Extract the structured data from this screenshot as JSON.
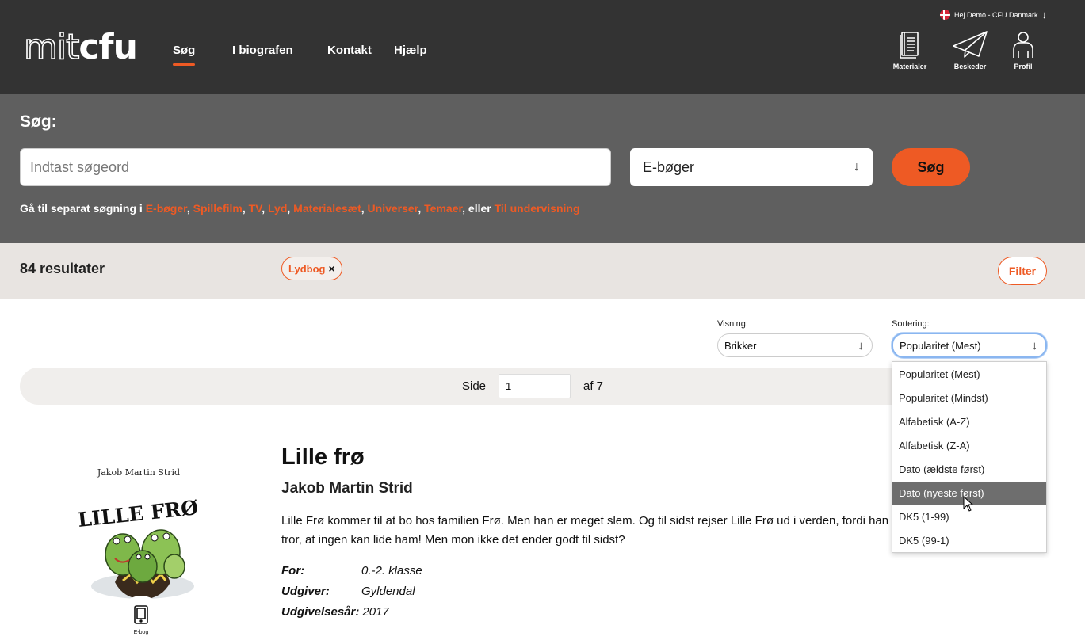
{
  "header": {
    "logo_thin": "mit",
    "logo_bold": "cfu",
    "nav": [
      {
        "label": "Søg",
        "active": true
      },
      {
        "label": "I biografen",
        "active": false
      },
      {
        "label": "Kontakt",
        "active": false
      },
      {
        "label": "Hjælp",
        "active": false
      }
    ],
    "greeting": "Hej Demo - CFU Danmark",
    "icons": [
      {
        "label": "Materialer",
        "icon": "book-icon"
      },
      {
        "label": "Beskeder",
        "icon": "paper-plane-icon"
      },
      {
        "label": "Profil",
        "icon": "person-icon"
      }
    ]
  },
  "search": {
    "title": "Søg:",
    "placeholder": "Indtast søgeord",
    "type_selected": "E-bøger",
    "button_label": "Søg",
    "links_prefix": "Gå til separat søgning i ",
    "links": [
      "E-bøger",
      "Spillefilm",
      "TV",
      "Lyd",
      "Materialesæt",
      "Universer",
      "Temaer"
    ],
    "links_or": ", eller ",
    "links_last": "Til undervisning"
  },
  "results": {
    "count_label": "84 resultater",
    "active_filter": "Lydbog",
    "filter_button": "Filter"
  },
  "controls": {
    "view_label": "Visning:",
    "view_value": "Brikker",
    "sort_label": "Sortering:",
    "sort_value": "Popularitet (Mest)",
    "sort_options": [
      "Popularitet (Mest)",
      "Popularitet (Mindst)",
      "Alfabetisk (A-Z)",
      "Alfabetisk (Z-A)",
      "Dato (ældste først)",
      "Dato (nyeste først)",
      "DK5 (1-99)",
      "DK5 (99-1)"
    ],
    "sort_highlighted_index": 5
  },
  "pager": {
    "side_label": "Side",
    "current_page": "1",
    "of_label": "af 7"
  },
  "product": {
    "cover_author": "Jakob Martin Strid",
    "cover_title": "LILLE FRØ",
    "badge_label": "E-bog",
    "title": "Lille frø",
    "author": "Jakob Martin Strid",
    "description": "Lille Frø kommer til at bo hos familien Frø. Men han er meget slem. Og til sidst rejser Lille Frø ud i verden, fordi han tror, at ingen kan lide ham! Men mon ikke det ender godt til sidst?",
    "meta": [
      {
        "key": "For:",
        "value": "0.-2. klasse"
      },
      {
        "key": "Udgiver:",
        "value": "Gyldendal"
      },
      {
        "key": "Udgivelsesår:",
        "value": "2017"
      }
    ]
  },
  "colors": {
    "accent": "#ee5a24",
    "header_bg": "#333333",
    "search_bg": "#5f5f5f",
    "results_bg": "#e8e4e1"
  }
}
